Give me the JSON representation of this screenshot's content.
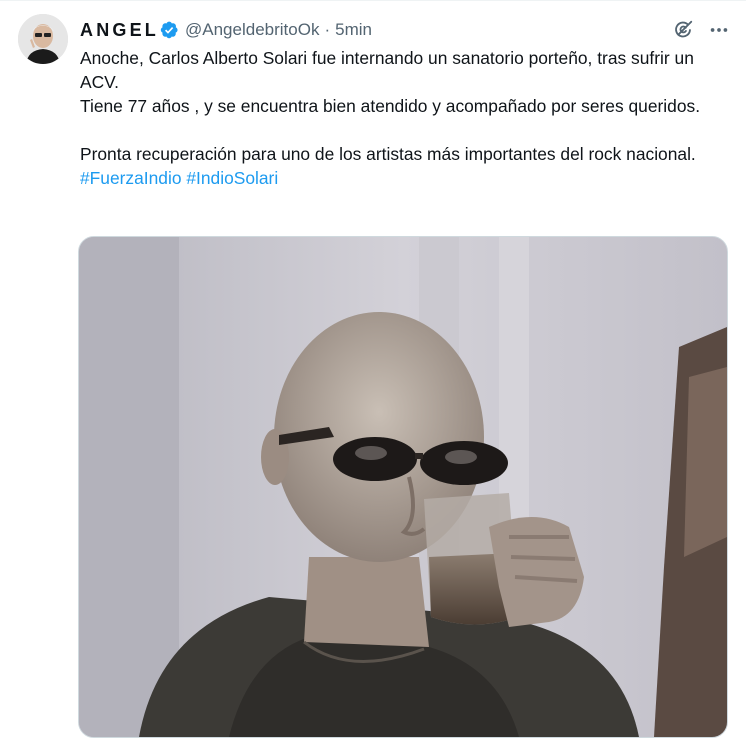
{
  "tweet": {
    "author": {
      "display_name": "ANGEL",
      "handle": "@AngeldebritoOk",
      "verified": true,
      "avatar_icon": "profile-photo"
    },
    "separator": "·",
    "timestamp": "5min",
    "text": {
      "line1": "Anoche, Carlos Alberto Solari fue internando un sanatorio porteño, tras sufrir un ACV.",
      "line2": "Tiene 77 años , y se encuentra bien atendido y acompañado por seres queridos.",
      "line3": "Pronta recuperación para uno de los artistas más importantes del rock nacional.",
      "hashtags": [
        "#FuerzaIndio",
        "#IndioSolari"
      ]
    },
    "media": {
      "type": "video-thumbnail"
    },
    "icons": {
      "grok": "grok-icon",
      "more": "more-icon"
    },
    "colors": {
      "accent": "#1d9bf0",
      "text": "#0f1419",
      "secondary_text": "#536471",
      "border": "#cfd9de"
    }
  }
}
